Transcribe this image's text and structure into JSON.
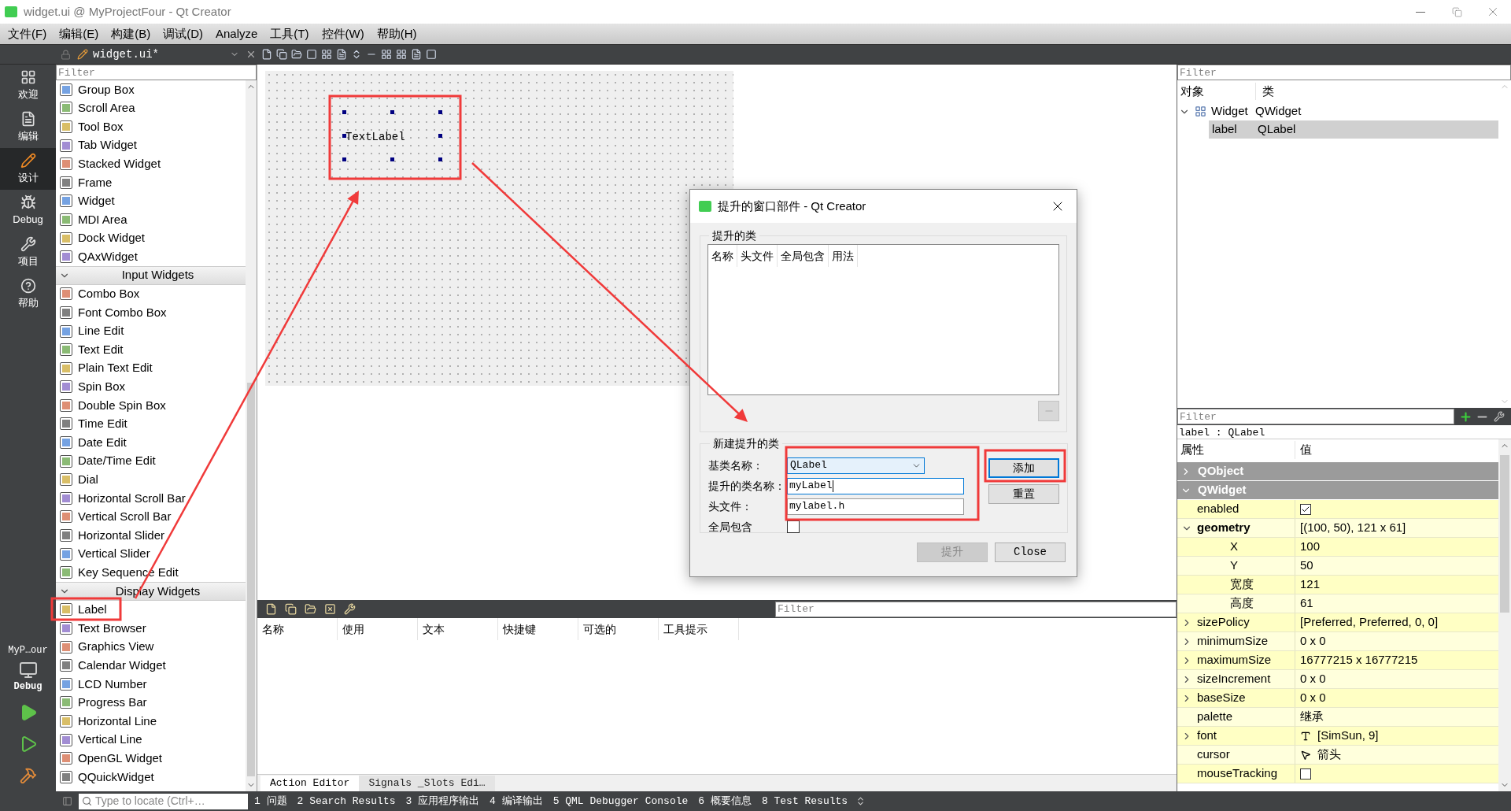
{
  "window": {
    "title": "widget.ui @ MyProjectFour - Qt Creator"
  },
  "menu": [
    "文件(F)",
    "编辑(E)",
    "构建(B)",
    "调试(D)",
    "Analyze",
    "工具(T)",
    "控件(W)",
    "帮助(H)"
  ],
  "toolbar": {
    "file_tab": "widget.ui*"
  },
  "mode_bar": {
    "items": [
      {
        "label": "欢迎",
        "kind": "welcome",
        "selected": false
      },
      {
        "label": "编辑",
        "kind": "edit",
        "selected": false
      },
      {
        "label": "设计",
        "kind": "design",
        "selected": true
      },
      {
        "label": "Debug",
        "kind": "debug",
        "selected": false
      },
      {
        "label": "项目",
        "kind": "projects",
        "selected": false
      },
      {
        "label": "帮助",
        "kind": "help",
        "selected": false
      }
    ],
    "project": "MyP…our",
    "kit": "Debug"
  },
  "widget_box": {
    "filter_placeholder": "Filter",
    "groups": [
      {
        "items": [
          "Group Box",
          "Scroll Area",
          "Tool Box",
          "Tab Widget",
          "Stacked Widget",
          "Frame",
          "Widget",
          "MDI Area",
          "Dock Widget",
          "QAxWidget"
        ]
      },
      {
        "title": "Input Widgets",
        "expanded": true,
        "items": [
          "Combo Box",
          "Font Combo Box",
          "Line Edit",
          "Text Edit",
          "Plain Text Edit",
          "Spin Box",
          "Double Spin Box",
          "Time Edit",
          "Date Edit",
          "Date/Time Edit",
          "Dial",
          "Horizontal Scroll Bar",
          "Vertical Scroll Bar",
          "Horizontal Slider",
          "Vertical Slider",
          "Key Sequence Edit"
        ]
      },
      {
        "title": "Display Widgets",
        "expanded": true,
        "items": [
          "Label",
          "Text Browser",
          "Graphics View",
          "Calendar Widget",
          "LCD Number",
          "Progress Bar",
          "Horizontal Line",
          "Vertical Line",
          "OpenGL Widget",
          "QQuickWidget"
        ]
      }
    ]
  },
  "form": {
    "label_text": "TextLabel"
  },
  "action_editor": {
    "filter_placeholder": "Filter",
    "columns": [
      "名称",
      "使用",
      "文本",
      "快捷键",
      "可选的",
      "工具提示"
    ],
    "tabs": [
      {
        "label": "Action Editor",
        "selected": true
      },
      {
        "label": "Signals _Slots Edi…",
        "selected": false
      }
    ]
  },
  "object_inspector": {
    "filter_placeholder": "Filter",
    "columns": [
      "对象",
      "类"
    ],
    "tree": [
      {
        "name": "Widget",
        "class": "QWidget",
        "expanded": true,
        "selected": false,
        "children": [
          {
            "name": "label",
            "class": "QLabel",
            "selected": true
          }
        ]
      }
    ]
  },
  "property_editor": {
    "filter_placeholder": "Filter",
    "object_label": "label : QLabel",
    "columns": [
      "属性",
      "值"
    ],
    "rows": [
      {
        "kind": "section",
        "name": "QObject",
        "expanded": false
      },
      {
        "kind": "section",
        "name": "QWidget",
        "expanded": true
      },
      {
        "kind": "checkbox",
        "name": "enabled",
        "checked": true
      },
      {
        "kind": "text",
        "name": "geometry",
        "value": "[(100, 50), 121 x 61]",
        "modified": true,
        "expanded": true,
        "children": [
          {
            "kind": "text",
            "name": "X",
            "value": "100"
          },
          {
            "kind": "text",
            "name": "Y",
            "value": "50"
          },
          {
            "kind": "text",
            "name": "宽度",
            "value": "121"
          },
          {
            "kind": "text",
            "name": "高度",
            "value": "61"
          }
        ]
      },
      {
        "kind": "text",
        "name": "sizePolicy",
        "value": "[Preferred, Preferred, 0, 0]",
        "expanded": false,
        "children": []
      },
      {
        "kind": "text",
        "name": "minimumSize",
        "value": "0 x 0",
        "expanded": false,
        "children": []
      },
      {
        "kind": "text",
        "name": "maximumSize",
        "value": "16777215 x 16777215",
        "expanded": false,
        "children": []
      },
      {
        "kind": "text",
        "name": "sizeIncrement",
        "value": "0 x 0",
        "expanded": false,
        "children": []
      },
      {
        "kind": "text",
        "name": "baseSize",
        "value": "0 x 0",
        "expanded": false,
        "children": []
      },
      {
        "kind": "text",
        "name": "palette",
        "value": "继承"
      },
      {
        "kind": "font",
        "name": "font",
        "value": "[SimSun, 9]",
        "expanded": false,
        "children": []
      },
      {
        "kind": "cursor",
        "name": "cursor",
        "value": "箭头"
      },
      {
        "kind": "checkbox",
        "name": "mouseTracking",
        "checked": false
      }
    ]
  },
  "dialog": {
    "title": "提升的窗口部件 - Qt Creator",
    "promoted_group": {
      "title": "提升的类",
      "columns": [
        "名称",
        "头文件",
        "全局包含",
        "用法"
      ]
    },
    "new_group": {
      "title": "新建提升的类",
      "fields": [
        {
          "kind": "combo",
          "label": "基类名称：",
          "value": "QLabel"
        },
        {
          "kind": "text",
          "label": "提升的类名称：",
          "value": "myLabel",
          "focused": true
        },
        {
          "kind": "text",
          "label": "头文件：",
          "value": "mylabel.h",
          "focused": false
        },
        {
          "kind": "checkbox",
          "label": "全局包含",
          "checked": false
        }
      ],
      "buttons": [
        {
          "label": "添加",
          "default": true
        },
        {
          "label": "重置",
          "default": false
        }
      ]
    },
    "buttons": [
      {
        "label": "提升",
        "disabled": true
      },
      {
        "label": "Close",
        "disabled": false
      }
    ]
  },
  "status_bar": {
    "locator_placeholder": "Type to locate (Ctrl+…",
    "panes": [
      "1 问题",
      "2 Search Results",
      "3 应用程序输出",
      "4 编译输出",
      "5 QML Debugger Console",
      "6 概要信息",
      "8 Test Results"
    ]
  }
}
